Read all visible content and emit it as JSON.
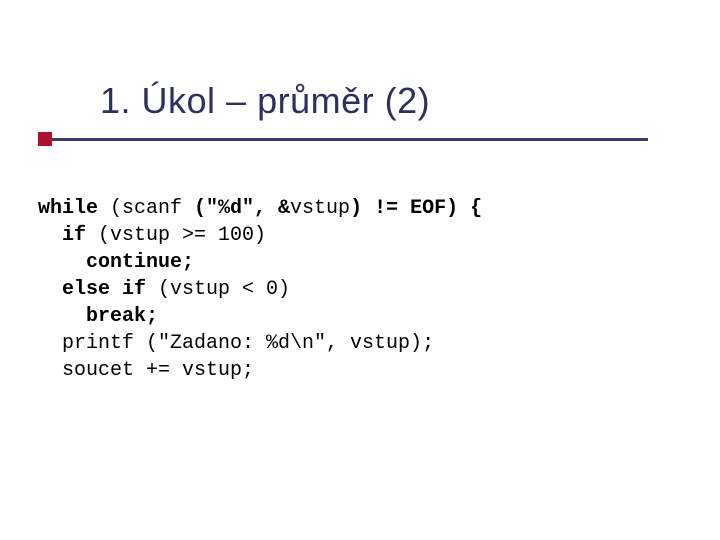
{
  "title": "1. Úkol – průměr (2)",
  "code": {
    "l1a": "while",
    "l1b": " (scanf ",
    "l1c": "(\"%d\", &",
    "l1d": "vstup",
    "l1e": ") != EOF) {",
    "l2a": "  if",
    "l2b": " (vstup >= 100)",
    "l3a": "    continue;",
    "l4a": "  else if",
    "l4b": " (vstup < 0)",
    "l5a": "    break;",
    "l6a": "  printf (\"Zadano: %d\\n\", vstup);",
    "l7a": "  soucet += vstup;"
  }
}
